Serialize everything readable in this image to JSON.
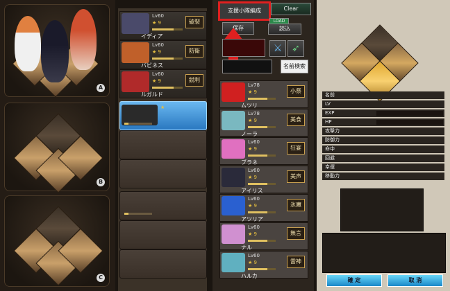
{
  "highlight_button": "支援小隊編成",
  "clear_button": "Clear",
  "save_button": "保存",
  "load_button": "読込",
  "load_badge": "LOAD",
  "name_search": "名前検索",
  "formation_labels": [
    "A",
    "B",
    "C"
  ],
  "party": [
    {
      "lv": "Lv60",
      "stars": "★ 9",
      "skill": "破裂",
      "name": "イディア",
      "color": "#4a4a6a"
    },
    {
      "lv": "Lv60",
      "stars": "★ 9",
      "skill": "防衛",
      "name": "バビネス",
      "color": "#c0602a"
    },
    {
      "lv": "Lv60",
      "stars": "★ 9",
      "skill": "鋭利",
      "name": "ルガルド",
      "color": "#b02a2a"
    }
  ],
  "candidates": [
    {
      "lv": "Lv78",
      "stars": "★ 9",
      "skill": "小祭",
      "name": "ムツリ",
      "color": "#d02020"
    },
    {
      "lv": "Lv78",
      "stars": "★ 9",
      "skill": "美食",
      "name": "ノーラ",
      "color": "#7ab8c0"
    },
    {
      "lv": "Lv60",
      "stars": "★ 9",
      "skill": "狂宴",
      "name": "ブラネ",
      "color": "#e070c0"
    },
    {
      "lv": "Lv60",
      "stars": "★ 9",
      "skill": "美声",
      "name": "アイリス",
      "color": "#2a2a3a"
    },
    {
      "lv": "Lv60",
      "stars": "★ 9",
      "skill": "氷魔",
      "name": "アツリア",
      "color": "#2a60d0"
    },
    {
      "lv": "Lv60",
      "stars": "★ 9",
      "skill": "無言",
      "name": "ナル",
      "color": "#d090d0"
    },
    {
      "lv": "Lv60",
      "stars": "★ 9",
      "skill": "雷神",
      "name": "ハルカ",
      "color": "#60b0c0"
    }
  ],
  "selected_stars": "★",
  "stats": [
    "名前",
    "LV",
    "EXP",
    "HP",
    "攻撃力",
    "防御力",
    "命中",
    "回避",
    "幸運",
    "移動力"
  ],
  "confirm": "確 定",
  "cancel": "取 消"
}
